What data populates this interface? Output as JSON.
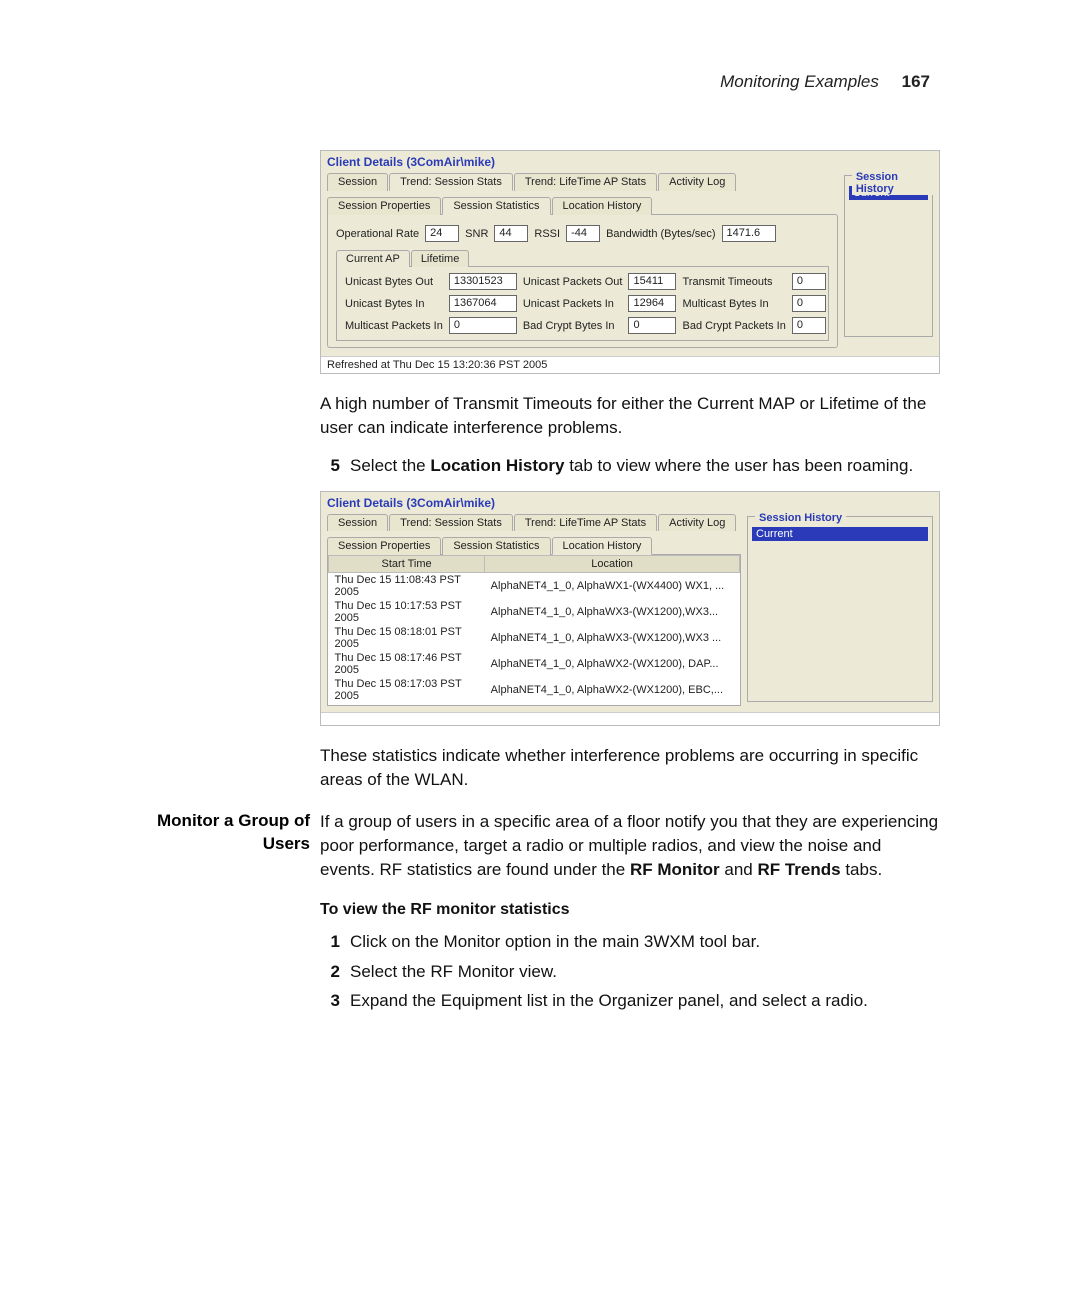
{
  "header": {
    "section": "Monitoring Examples",
    "page": "167"
  },
  "panel1": {
    "title": "Client Details (3ComAir\\mike)",
    "tabs": [
      "Session",
      "Trend: Session Stats",
      "Trend: LifeTime AP Stats",
      "Activity Log"
    ],
    "subtabs": [
      "Session Properties",
      "Session Statistics",
      "Location History"
    ],
    "line1": {
      "l0": "Operational Rate",
      "v0": "24",
      "l1": "SNR",
      "v1": "44",
      "l2": "RSSI",
      "v2": "-44",
      "l3": "Bandwidth (Bytes/sec)",
      "v3": "1471.6"
    },
    "innerTabs": [
      "Current AP",
      "Lifetime"
    ],
    "rows": [
      {
        "l0": "Unicast Bytes Out",
        "v0": "13301523",
        "l1": "Unicast Packets Out",
        "v1": "15411",
        "l2": "Transmit Timeouts",
        "v2": "0"
      },
      {
        "l0": "Unicast Bytes In",
        "v0": "1367064",
        "l1": "Unicast Packets In",
        "v1": "12964",
        "l2": "Multicast Bytes In",
        "v2": "0"
      },
      {
        "l0": "Multicast Packets In",
        "v0": "0",
        "l1": "Bad Crypt Bytes In",
        "v1": "0",
        "l2": "Bad Crypt Packets In",
        "v2": "0"
      }
    ],
    "history": {
      "title": "Session History",
      "current": "Current"
    },
    "footer": "Refreshed at Thu Dec 15 13:20:36 PST 2005"
  },
  "panel2": {
    "title": "Client Details (3ComAir\\mike)",
    "tabs": [
      "Session",
      "Trend: Session Stats",
      "Trend: LifeTime AP Stats",
      "Activity Log"
    ],
    "subtabs": [
      "Session Properties",
      "Session Statistics",
      "Location History"
    ],
    "table": {
      "cols": [
        "Start Time",
        "Location"
      ],
      "rows": [
        [
          "Thu Dec 15 11:08:43 PST 2005",
          "AlphaNET4_1_0, AlphaWX1-(WX4400) WX1, ..."
        ],
        [
          "Thu Dec 15 10:17:53 PST 2005",
          "AlphaNET4_1_0, AlphaWX3-(WX1200),WX3..."
        ],
        [
          "Thu Dec 15 08:18:01 PST 2005",
          "AlphaNET4_1_0, AlphaWX3-(WX1200),WX3 ..."
        ],
        [
          "Thu Dec 15 08:17:46 PST 2005",
          "AlphaNET4_1_0, AlphaWX2-(WX1200), DAP..."
        ],
        [
          "Thu Dec 15 08:17:03 PST 2005",
          "AlphaNET4_1_0, AlphaWX2-(WX1200), EBC,..."
        ]
      ]
    },
    "history": {
      "title": "Session History",
      "current": "Current"
    }
  },
  "body": {
    "p1": "A high number of Transmit Timeouts for either the Current MAP or Lifetime of the user can indicate interference problems.",
    "step5": {
      "num": "5",
      "pre": "Select the ",
      "bold": "Location History",
      "post": " tab to view where the user has been roaming."
    },
    "p2": "These statistics indicate whether interference problems are occurring in specific areas of the WLAN.",
    "sideHeading": {
      "l1": "Monitor a Group of",
      "l2": "Users"
    },
    "p3": {
      "pre": "If a group of users in a specific area of a floor notify you that they are experiencing poor performance, target a radio or multiple radios, and view the noise and events. RF statistics are found under the ",
      "b1": "RF Monitor",
      "mid": " and ",
      "b2": "RF Trends",
      "post": " tabs."
    },
    "subHeading": "To view the RF monitor statistics",
    "steps": [
      {
        "num": "1",
        "txt": "Click on the Monitor option in the main 3WXM tool bar."
      },
      {
        "num": "2",
        "txt": "Select the RF Monitor view."
      },
      {
        "num": "3",
        "txt": "Expand the Equipment list in the Organizer panel, and select a radio."
      }
    ]
  }
}
